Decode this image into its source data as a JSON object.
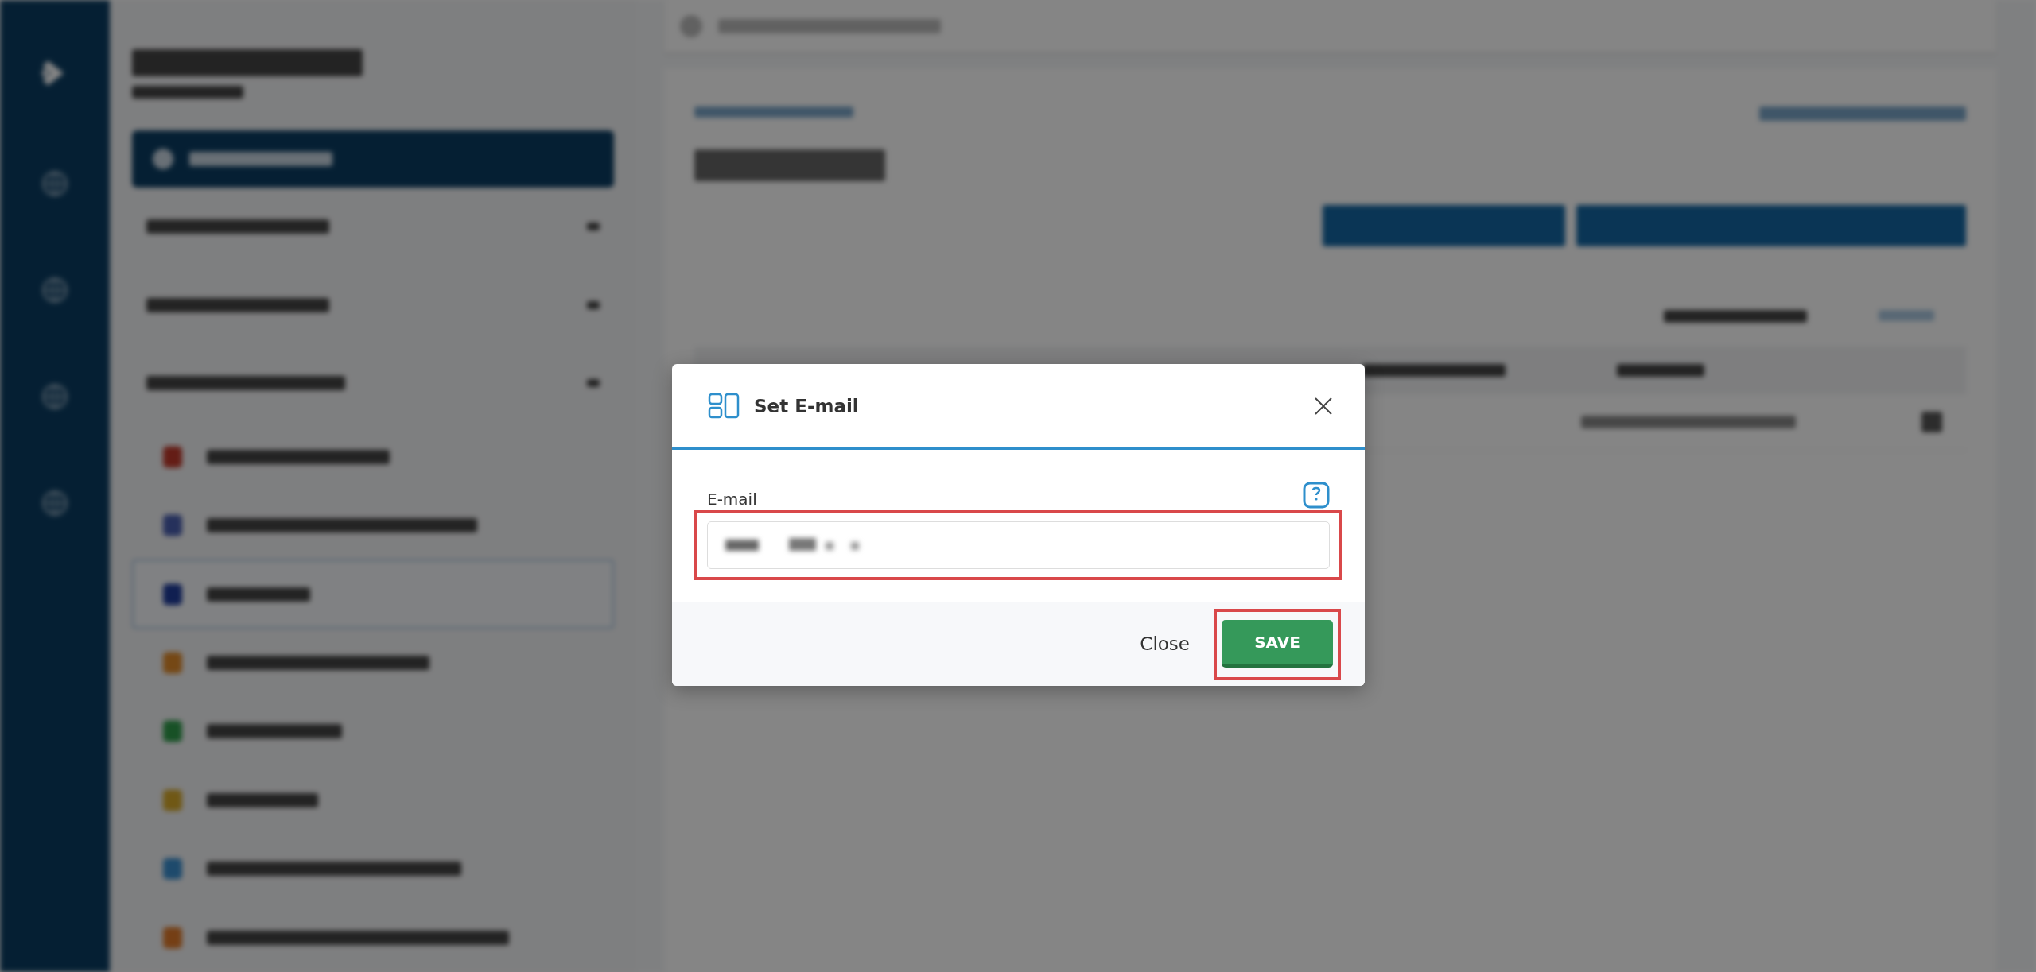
{
  "dialog": {
    "title": "Set E-mail",
    "field": {
      "label": "E-mail",
      "highlighted": true
    },
    "buttons": [
      {
        "label": "Close",
        "kind": "link",
        "highlighted": false
      },
      {
        "label": "SAVE",
        "kind": "primary",
        "highlighted": true
      }
    ]
  }
}
